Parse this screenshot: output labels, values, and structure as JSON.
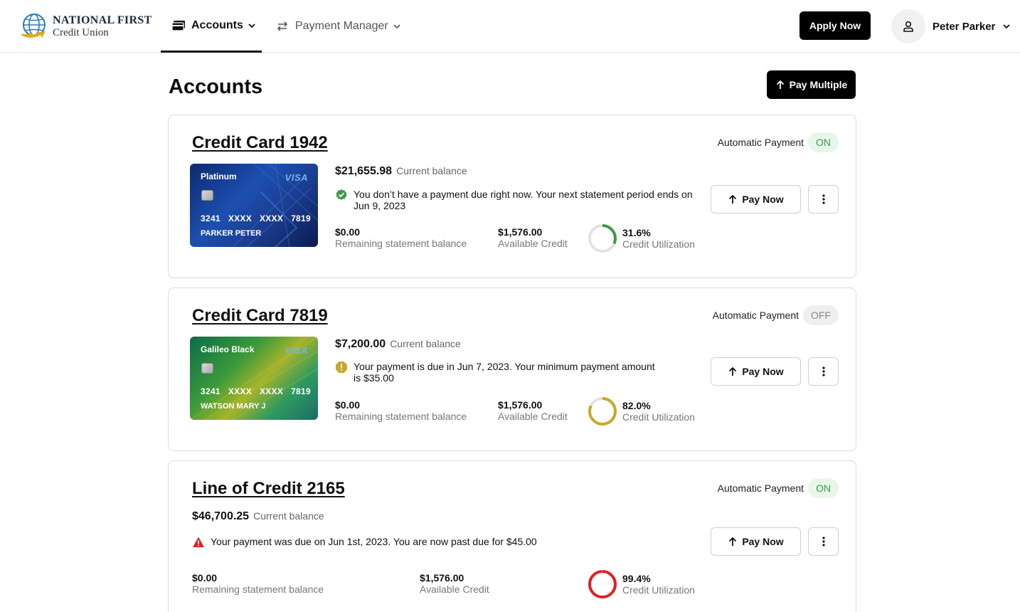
{
  "brand": {
    "name_line1": "NATIONAL FIRST",
    "name_line2": "Credit Union"
  },
  "nav": {
    "accounts_label": "Accounts",
    "payments_label": "Payment Manager"
  },
  "header": {
    "apply_label": "Apply Now",
    "user_name": "Peter Parker"
  },
  "page": {
    "title": "Accounts",
    "pay_multiple_label": "Pay Multiple"
  },
  "colors": {
    "on_green": "#3e9a48",
    "warning_gold": "#c9a82a",
    "danger_red": "#e02020",
    "ring_track": "#e2e2e2"
  },
  "accounts": [
    {
      "title": "Credit Card 1942",
      "autopay_label": "Automatic Payment",
      "autopay_state": "ON",
      "card_name": "Platinum",
      "card_network": "VISA",
      "card_number": [
        "3241",
        "XXXX",
        "XXXX",
        "7819"
      ],
      "card_holder": "PARKER PETER",
      "balance": "$21,655.98",
      "balance_label": "Current balance",
      "status_icon": "check-circle-icon",
      "message": "You don’t have a payment due right now. Your next statement period ends on Jun 9, 2023",
      "remaining_value": "$0.00",
      "remaining_label": "Remaining statement balance",
      "available_value": "$1,576.00",
      "available_label": "Available Credit",
      "utilization_value": "31.6%",
      "utilization_label": "Credit Utilization",
      "utilization_fraction": 0.316,
      "ring_color": "#3e9a48",
      "pay_now_label": "Pay Now"
    },
    {
      "title": "Credit Card 7819",
      "autopay_label": "Automatic Payment",
      "autopay_state": "OFF",
      "card_name": "Galileo Black",
      "card_network": "VISA",
      "card_number": [
        "3241",
        "XXXX",
        "XXXX",
        "7819"
      ],
      "card_holder": "WATSON MARY J",
      "balance": "$7,200.00",
      "balance_label": "Current balance",
      "status_icon": "warning-circle-icon",
      "message": "Your payment is due in Jun 7, 2023. Your minimum payment amount is $35.00",
      "remaining_value": "$0.00",
      "remaining_label": "Remaining statement balance",
      "available_value": "$1,576.00",
      "available_label": "Available Credit",
      "utilization_value": "82.0%",
      "utilization_label": "Credit Utilization",
      "utilization_fraction": 0.82,
      "ring_color": "#c9a82a",
      "pay_now_label": "Pay Now"
    },
    {
      "title": "Line of Credit 2165",
      "autopay_label": "Automatic Payment",
      "autopay_state": "ON",
      "balance": "$46,700.25",
      "balance_label": "Current balance",
      "status_icon": "alert-triangle-icon",
      "message": "Your payment was due on Jun 1st, 2023. You are now past due for $45.00",
      "remaining_value": "$0.00",
      "remaining_label": "Remaining statement balance",
      "available_value": "$1,576.00",
      "available_label": "Available Credit",
      "utilization_value": "99.4%",
      "utilization_label": "Credit Utilization",
      "utilization_fraction": 0.994,
      "ring_color": "#e02020",
      "pay_now_label": "Pay Now"
    }
  ]
}
